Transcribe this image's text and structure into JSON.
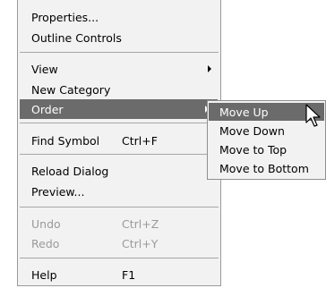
{
  "menu": {
    "items": [
      {
        "label": "Properties..."
      },
      {
        "label": "Outline Controls"
      },
      {
        "label": "View"
      },
      {
        "label": "New Category"
      },
      {
        "label": "Order"
      },
      {
        "label": "Find Symbol",
        "shortcut": "Ctrl+F"
      },
      {
        "label": "Reload Dialog"
      },
      {
        "label": "Preview..."
      },
      {
        "label": "Undo",
        "shortcut": "Ctrl+Z"
      },
      {
        "label": "Redo",
        "shortcut": "Ctrl+Y"
      },
      {
        "label": "Help",
        "shortcut": "F1"
      }
    ]
  },
  "submenu": {
    "items": [
      {
        "label": "Move Up"
      },
      {
        "label": "Move Down"
      },
      {
        "label": "Move to Top"
      },
      {
        "label": "Move to Bottom"
      }
    ]
  },
  "colors": {
    "menu_bg": "#f2f2f2",
    "highlight_bg": "#6b6b6b",
    "disabled_text": "#9a9a9a"
  },
  "icons": [
    "submenu-arrow-icon",
    "mouse-cursor-icon"
  ]
}
